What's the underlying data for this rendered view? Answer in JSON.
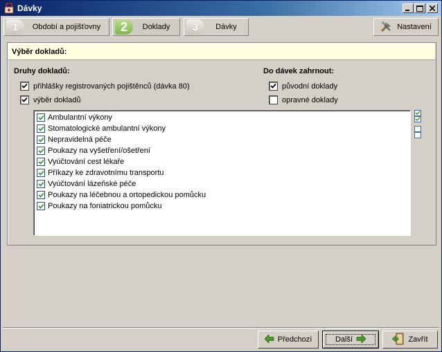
{
  "window": {
    "title": "Dávky",
    "buttons": {
      "minimize": "minimize",
      "maximize": "maximize",
      "close": "close"
    }
  },
  "steps": [
    {
      "number": "1",
      "label": "Období a pojišťovny",
      "active": false
    },
    {
      "number": "2",
      "label": "Doklady",
      "active": true
    },
    {
      "number": "3",
      "label": "Dávky",
      "active": false
    }
  ],
  "settings_button": {
    "label": "Nastavení",
    "icon": "tools-icon"
  },
  "panel": {
    "header": "Výběr dokladů:",
    "doc_types": {
      "title": "Druhy dokladů:",
      "options": [
        {
          "label": "přihlášky registrovaných pojištěnců (dávka 80)",
          "checked": true
        },
        {
          "label": "výběr dokladů",
          "checked": true
        }
      ]
    },
    "include": {
      "title": "Do dávek zahrnout:",
      "options": [
        {
          "label": "původní doklady",
          "checked": true
        },
        {
          "label": "opravné doklady",
          "checked": false
        }
      ]
    },
    "documents": [
      {
        "label": "Ambulantní výkony",
        "checked": true
      },
      {
        "label": "Stomatologické ambulantní výkony",
        "checked": true
      },
      {
        "label": "Nepravidelná péče",
        "checked": true
      },
      {
        "label": "Poukazy na vyšetření/ošetření",
        "checked": true
      },
      {
        "label": "Vyúčtování cest lékaře",
        "checked": true
      },
      {
        "label": "Příkazy ke zdravotnímu transportu",
        "checked": true
      },
      {
        "label": "Vyúčtování lázeňské péče",
        "checked": true
      },
      {
        "label": "Poukazy na léčebnou a ortopedickou pomůcku",
        "checked": true
      },
      {
        "label": "Poukazy na foniatrickou pomůcku",
        "checked": true
      }
    ],
    "side_icons": [
      "check-all-icon",
      "uncheck-all-icon"
    ]
  },
  "footer": {
    "prev": {
      "label": "Předchozí",
      "icon": "arrow-left-icon"
    },
    "next": {
      "label": "Další",
      "icon": "arrow-right-icon"
    },
    "close": {
      "label": "Zavřít",
      "icon": "exit-door-icon"
    }
  },
  "colors": {
    "title_gradient_start": "#0a246a",
    "panel_header_bg": "#ffffe1",
    "accent_green": "#4a9a2a",
    "checkbox_border": "#1c5180"
  }
}
